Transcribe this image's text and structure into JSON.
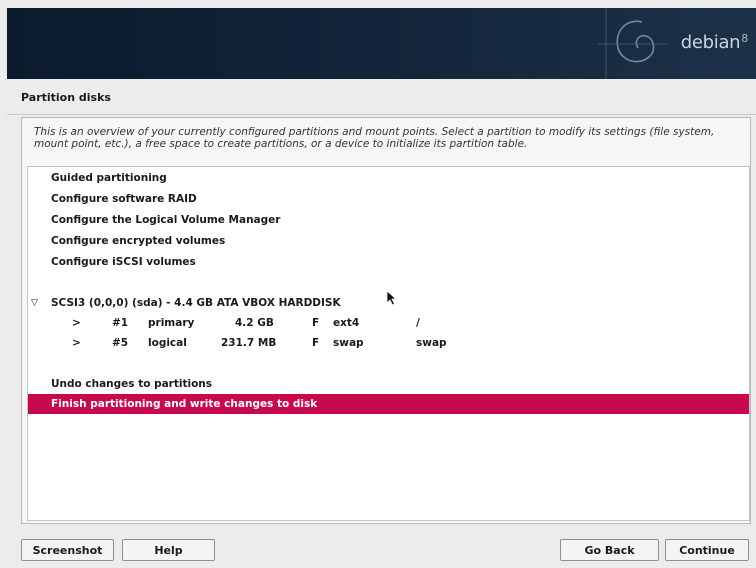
{
  "banner": {
    "logo_text": "debian",
    "logo_version": "8"
  },
  "page": {
    "title": "Partition disks",
    "description": "This is an overview of your currently configured partitions and mount points. Select a partition to modify its settings (file system, mount point, etc.), a free space to create partitions, or a device to initialize its partition table."
  },
  "menu": {
    "guided": "Guided partitioning",
    "raid": "Configure software RAID",
    "lvm": "Configure the Logical Volume Manager",
    "encrypted": "Configure encrypted volumes",
    "iscsi": "Configure iSCSI volumes",
    "disk": "SCSI3 (0,0,0) (sda) - 4.4 GB ATA VBOX HARDDISK",
    "disk_expand": "▽",
    "undo": "Undo changes to partitions",
    "finish": "Finish partitioning and write changes to disk",
    "selected_item": "finish"
  },
  "partitions": [
    {
      "arrow": ">",
      "num": "#1",
      "type": "primary",
      "size": "4.2 GB",
      "flag": "F",
      "fs": "ext4",
      "mount": "/"
    },
    {
      "arrow": ">",
      "num": "#5",
      "type": "logical",
      "size": "231.7 MB",
      "flag": "F",
      "fs": "swap",
      "mount": "swap"
    }
  ],
  "buttons": {
    "screenshot": "Screenshot",
    "help": "Help",
    "go_back": "Go Back",
    "continue": "Continue"
  },
  "colors": {
    "selection": "#c8094e",
    "banner": "#0b1b2d"
  }
}
